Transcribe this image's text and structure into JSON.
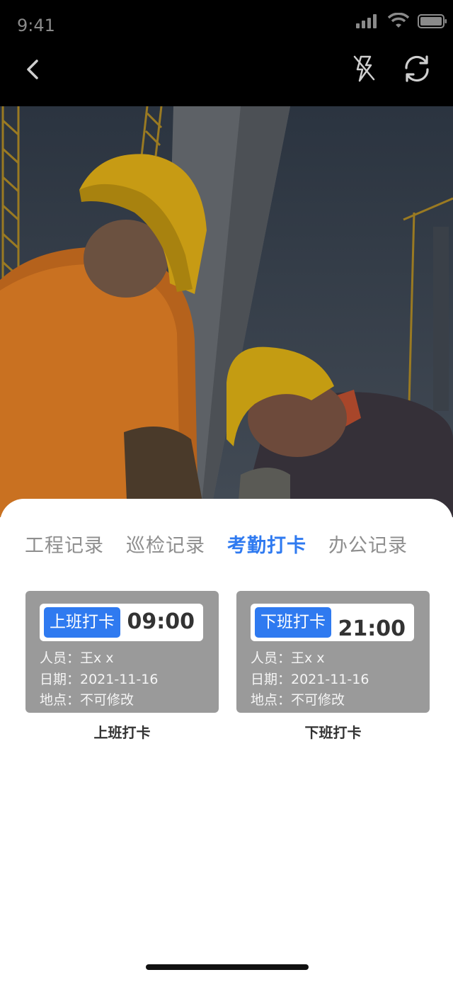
{
  "status_bar": {
    "time": "9:41"
  },
  "toolbar": {
    "back_icon": "chevron-left-icon",
    "flash_icon": "flash-off-icon",
    "switch_icon": "camera-switch-icon"
  },
  "tabs": [
    {
      "label": "工程记录"
    },
    {
      "label": "巡检记录"
    },
    {
      "label": "考勤打卡"
    },
    {
      "label": "办公记录"
    }
  ],
  "active_tab_index": 2,
  "cards": [
    {
      "tag": "上班打卡",
      "time": "09:00",
      "person": "人员：王x x",
      "date": "日期：2021-11-16",
      "location": "地点：不可修改",
      "caption": "上班打卡"
    },
    {
      "tag": "下班打卡",
      "time": "21:00",
      "person": "人员：王x x",
      "date": "日期：2021-11-16",
      "location": "地点：不可修改",
      "caption": "下班打卡"
    }
  ],
  "colors": {
    "accent": "#2f7af0",
    "card_bg": "#9a9a9a",
    "topbar_bg": "#000000"
  }
}
